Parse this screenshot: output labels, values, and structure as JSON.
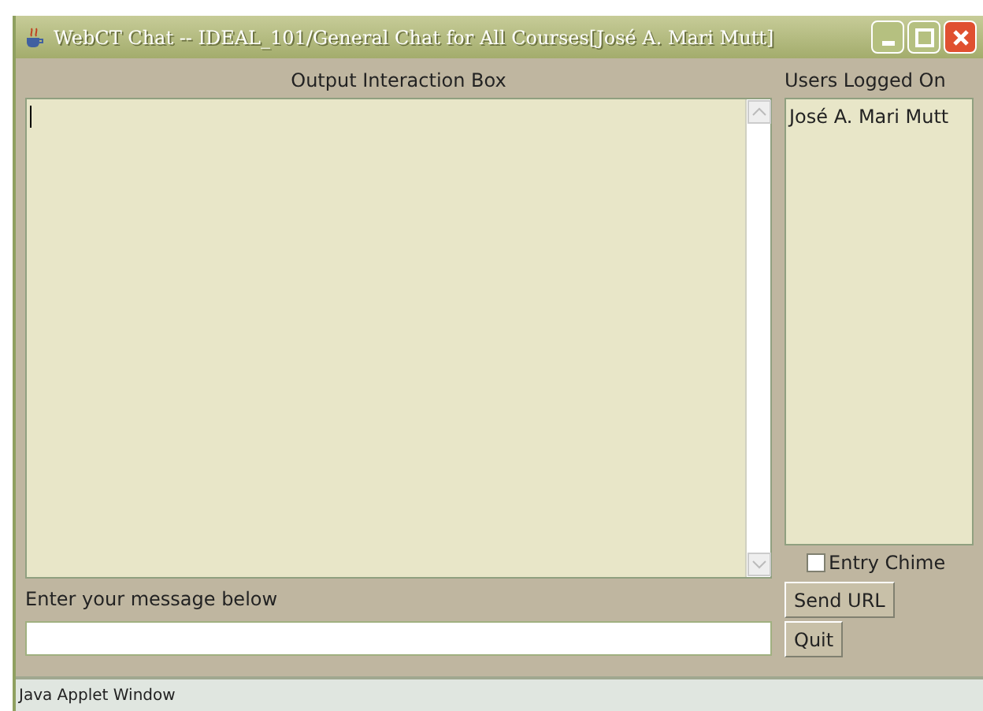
{
  "window": {
    "title": "WebCT Chat -- IDEAL_101/General Chat for All Courses[José A. Mari Mutt]"
  },
  "output": {
    "label": "Output Interaction Box"
  },
  "users": {
    "label": "Users Logged On",
    "items": [
      "José A. Mari Mutt"
    ]
  },
  "entry_chime": {
    "label": "Entry Chime",
    "checked": false
  },
  "message": {
    "label": "Enter your message below"
  },
  "buttons": [
    "Send URL",
    "Quit"
  ],
  "status_bar": "Java Applet Window"
}
